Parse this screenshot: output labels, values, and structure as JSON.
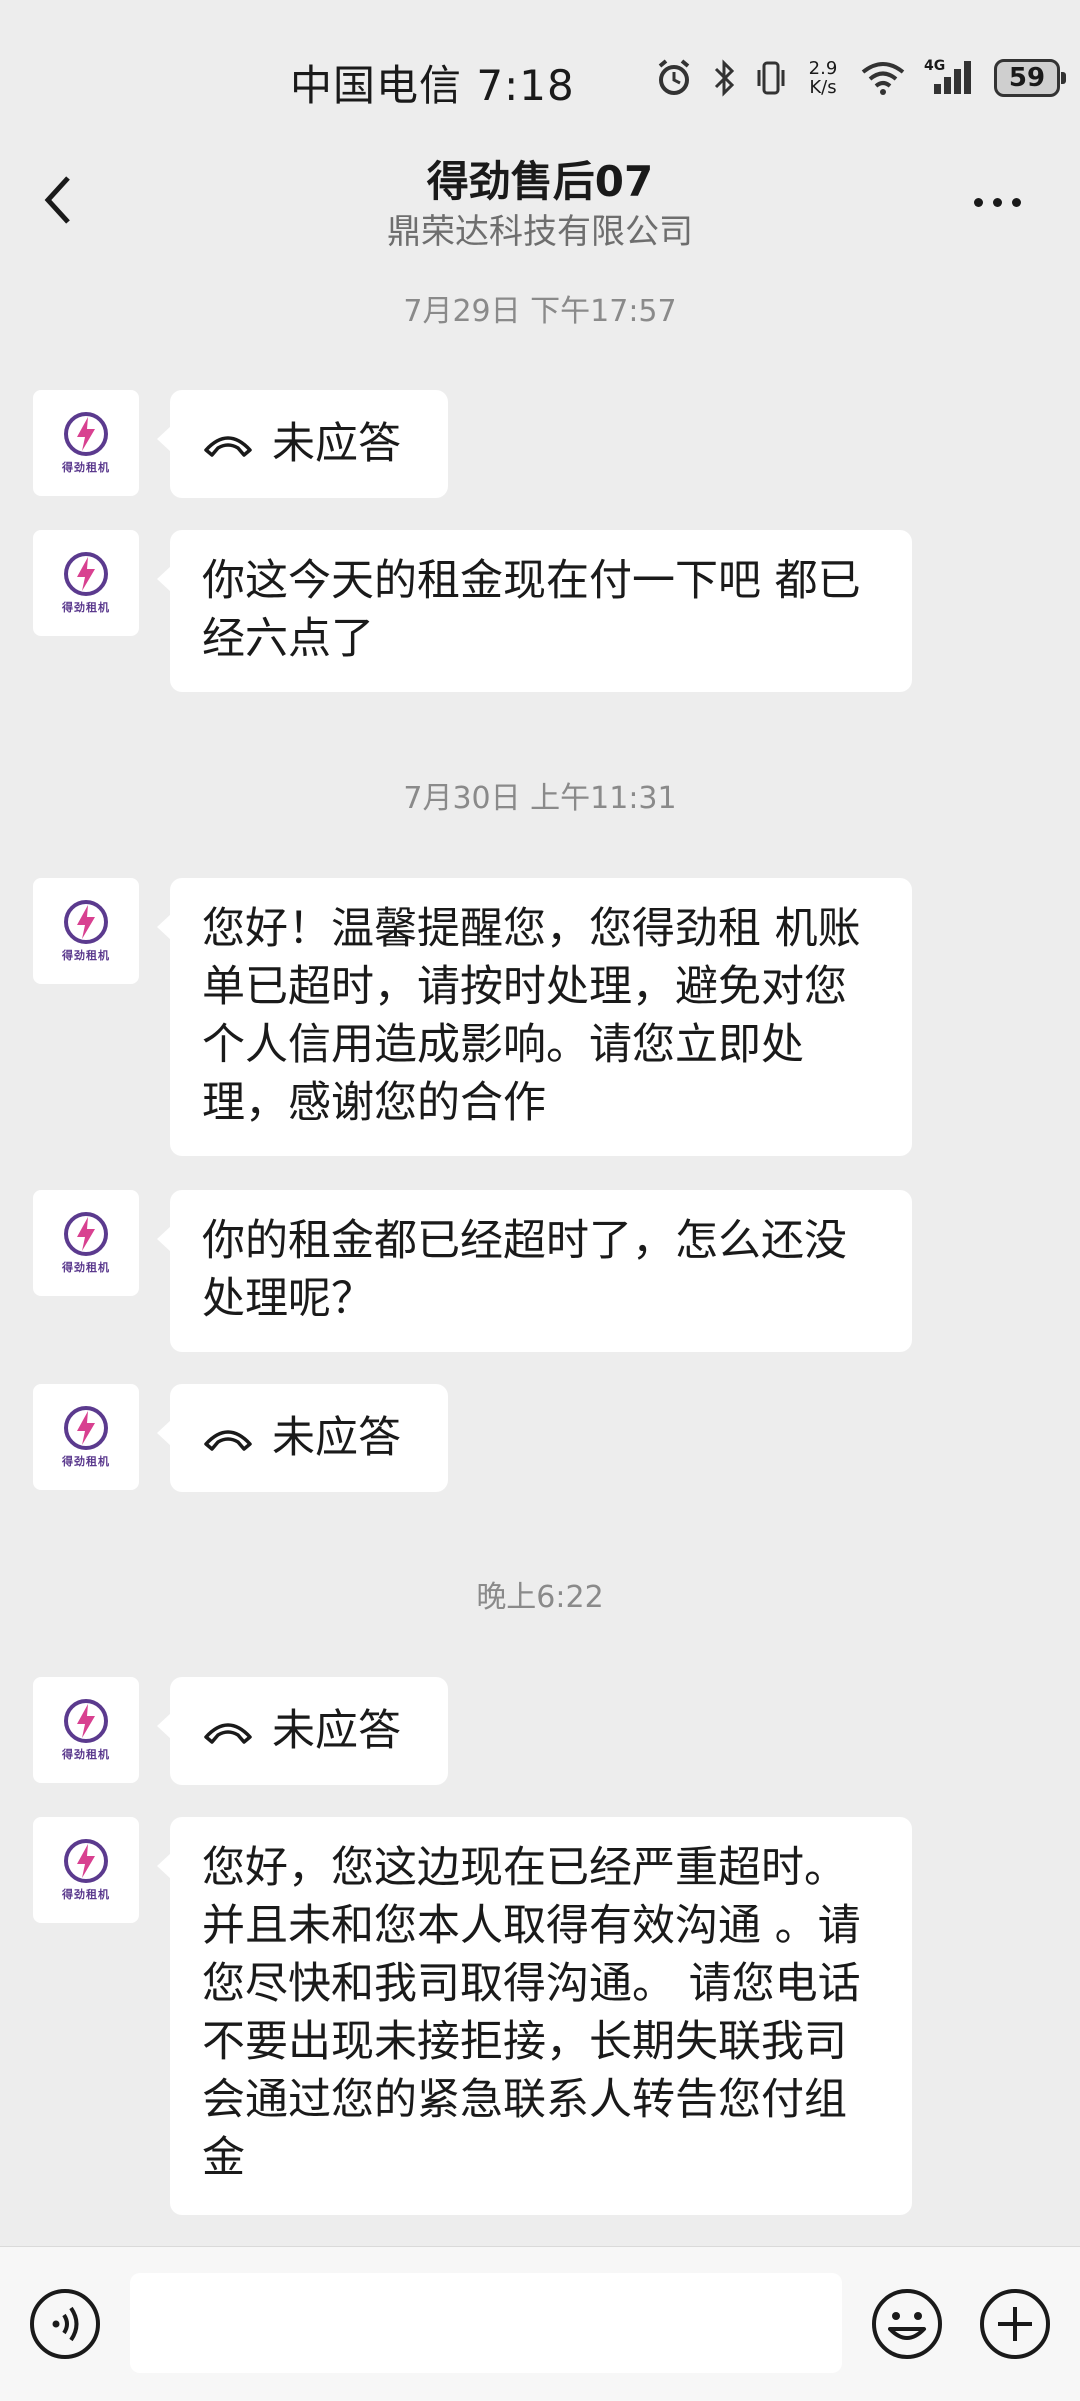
{
  "status_bar": {
    "carrier_time": "中国电信 7:18",
    "net_speed_value": "2.9",
    "net_speed_unit": "K/s",
    "network_type": "4G",
    "battery": "59"
  },
  "header": {
    "title": "得劲售后07",
    "subtitle": "鼎荣达科技有限公司"
  },
  "avatar_label": "得劲租机",
  "messages": {
    "ts1": "7月29日 下午17:57",
    "m1": "未应答",
    "m2": "你这今天的租金现在付一下吧  都已经六点了",
    "ts2": "7月30日 上午11:31",
    "m3": "您好！温馨提醒您，您得劲租  机账  单已超时，请按时处理，避免对您个人信用造成影响。请您立即处理，感谢您的合作",
    "m4": "你的租金都已经超时了，怎么还没处理呢？",
    "m5": "未应答",
    "ts3": "晚上6:22",
    "m6": "未应答",
    "m7": "您好，您这边现在已经严重超时。并且未和您本人取得有效沟通  。请您尽快和我司取得沟通。 请您电话不要出现未接拒接，长期失联我司会通过您的紧急联系人转告您付组金"
  },
  "icons": {
    "back": "chevron-left-icon",
    "more": "more-dots-icon",
    "call": "phone-hangup-icon",
    "voice": "voice-icon",
    "emoji": "emoji-icon",
    "plus": "plus-icon"
  }
}
